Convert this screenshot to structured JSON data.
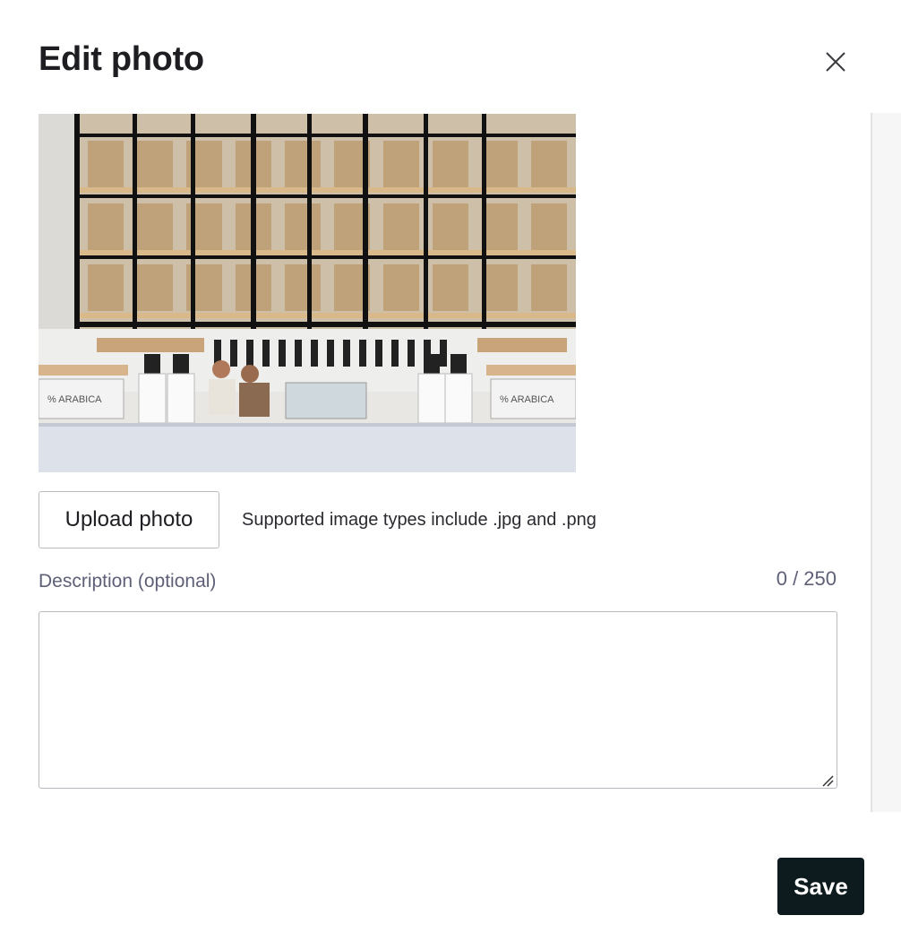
{
  "dialog": {
    "title": "Edit photo",
    "close_icon": "close-icon"
  },
  "photo": {
    "description": "cafe-counter-photo",
    "sign_text": "% ARABICA"
  },
  "upload": {
    "button_label": "Upload photo",
    "hint": "Supported image types include .jpg and .png"
  },
  "description": {
    "label": "Description (optional)",
    "counter": "0 / 250",
    "value": "",
    "placeholder": ""
  },
  "footer": {
    "save_label": "Save"
  },
  "colors": {
    "primary_button": "#0d1b1e",
    "label_text": "#5e6078",
    "border": "#b9b9bf"
  }
}
